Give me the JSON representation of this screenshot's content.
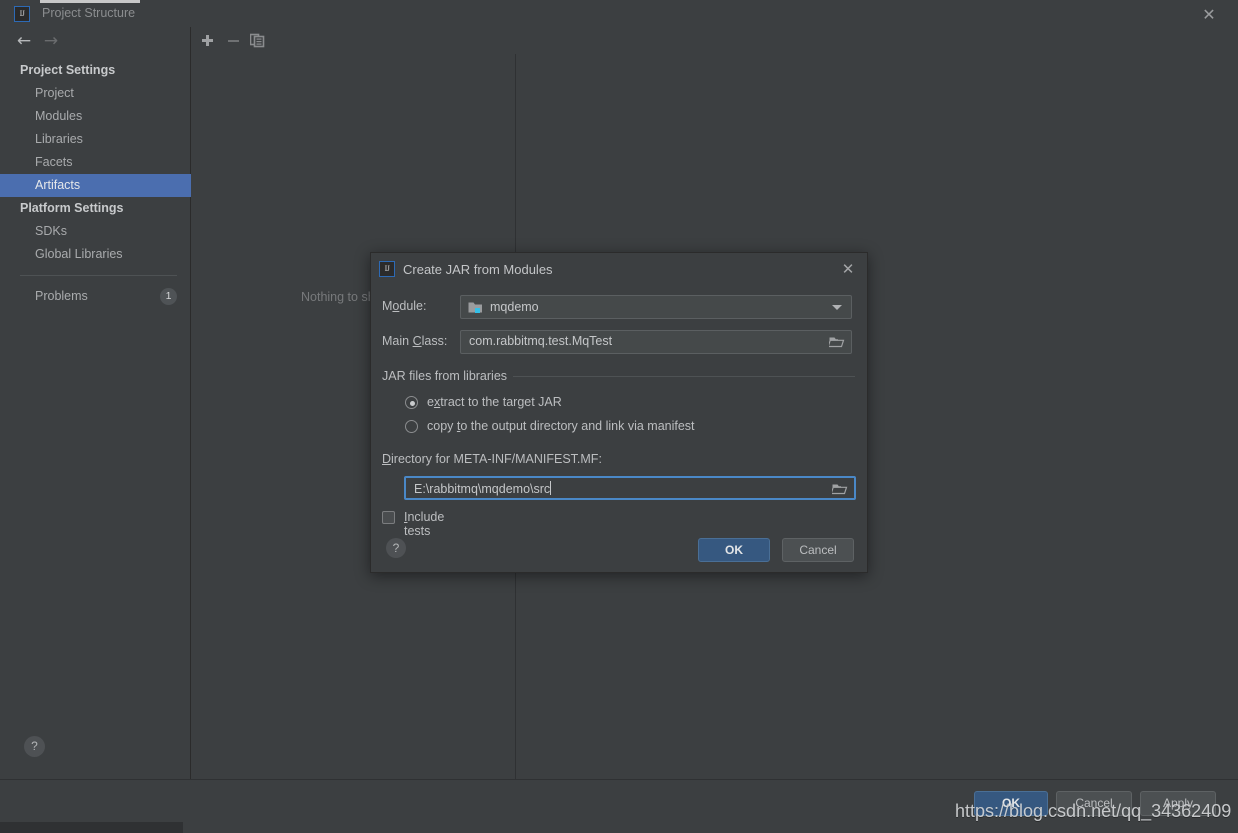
{
  "window": {
    "title": "Project Structure",
    "icon": "intellij-idea-icon",
    "icon_text": "IJ",
    "close_label": "✕"
  },
  "sidebar": {
    "nav_back": "←",
    "nav_forward": "→",
    "groups": [
      {
        "label": "Project Settings",
        "items": [
          {
            "label": "Project",
            "selected": false
          },
          {
            "label": "Modules",
            "selected": false
          },
          {
            "label": "Libraries",
            "selected": false
          },
          {
            "label": "Facets",
            "selected": false
          },
          {
            "label": "Artifacts",
            "selected": true
          }
        ]
      },
      {
        "label": "Platform Settings",
        "items": [
          {
            "label": "SDKs",
            "selected": false
          },
          {
            "label": "Global Libraries",
            "selected": false
          }
        ]
      }
    ],
    "problems": {
      "label": "Problems",
      "count": "1"
    },
    "help_label": "?"
  },
  "toolbar": {
    "add_label": "+",
    "remove_label": "−",
    "copy_label": "copy-icon"
  },
  "main": {
    "empty_text": "Nothing to show"
  },
  "footer": {
    "ok_label": "OK",
    "cancel_label": "Cancel",
    "apply_label": "Apply",
    "watermark": "https://blog.csdn.net/qq_34362409"
  },
  "dialog": {
    "title": "Create JAR from Modules",
    "icon_text": "IJ",
    "close_label": "✕",
    "module": {
      "label_pre": "M",
      "label_mnemonic": "o",
      "label_post": "dule:",
      "value": "mqdemo",
      "icon": "module-folder-icon"
    },
    "main_class": {
      "label_pre": "Main ",
      "label_mnemonic": "C",
      "label_post": "lass:",
      "value": "com.rabbitmq.test.MqTest",
      "placeholder": "",
      "browse_icon": "folder-browse-icon"
    },
    "jar_group": {
      "title": "JAR files from libraries",
      "options": [
        {
          "pre": "e",
          "mnemonic": "x",
          "post": "tract to the target JAR",
          "full": "extract to the target JAR",
          "checked": true
        },
        {
          "pre": "copy ",
          "mnemonic": "t",
          "post": "o the output directory and link via manifest",
          "full": "copy to the output directory and link via manifest",
          "checked": false
        }
      ]
    },
    "manifest_dir": {
      "label_pre": "",
      "label_mnemonic": "D",
      "label_post": "irectory for META-INF/MANIFEST.MF:",
      "full_label": "Directory for META-INF/MANIFEST.MF:",
      "value": "E:\\rabbitmq\\mqdemo\\src",
      "browse_icon": "folder-browse-icon",
      "focused": true
    },
    "include_tests": {
      "label_pre": "",
      "label_mnemonic": "I",
      "label_post": "nclude tests",
      "full_label": "Include tests",
      "checked": false
    },
    "help_label": "?",
    "ok_label": "OK",
    "cancel_label": "Cancel"
  },
  "colors": {
    "background": "#3c3f41",
    "panel_border": "#2b2b2b",
    "selection": "#4b6eaf",
    "primary_button": "#365880",
    "focus_border": "#4a88c7",
    "text": "#bbbbbb"
  }
}
